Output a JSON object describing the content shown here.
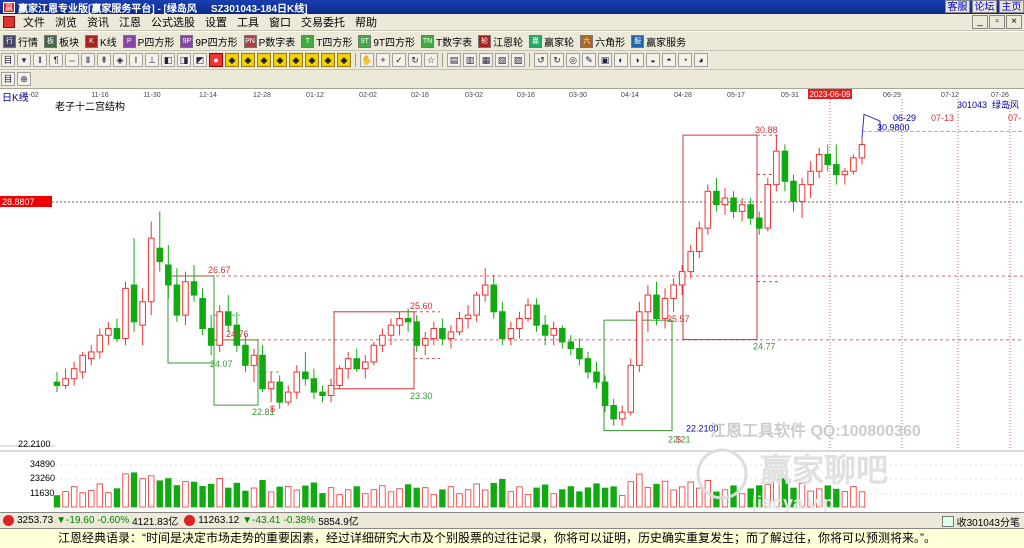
{
  "window": {
    "title": "赢家江恩专业版[赢家服务平台] - [绿岛风",
    "code_title": "SZ301043-184日K线]",
    "links": [
      "客服",
      "论坛",
      "主页"
    ]
  },
  "menu": [
    "文件",
    "浏览",
    "资讯",
    "江恩",
    "公式选股",
    "设置",
    "工具",
    "窗口",
    "交易委托",
    "帮助"
  ],
  "toolbar1": [
    {
      "icon": "行",
      "label": "行情",
      "color": "#446"
    },
    {
      "icon": "板",
      "label": "板块",
      "color": "#464"
    },
    {
      "icon": "K",
      "label": "K线",
      "color": "#a22"
    },
    {
      "icon": "P",
      "label": "P四方形",
      "color": "#84a"
    },
    {
      "icon": "9P",
      "label": "9P四方形",
      "color": "#84a"
    },
    {
      "icon": "PN",
      "label": "P数字表",
      "color": "#a44"
    },
    {
      "icon": "T",
      "label": "T四方形",
      "color": "#4a4"
    },
    {
      "icon": "9T",
      "label": "9T四方形",
      "color": "#4a4"
    },
    {
      "icon": "TN",
      "label": "T数字表",
      "color": "#4a4"
    },
    {
      "icon": "轮",
      "label": "江恩轮",
      "color": "#a22"
    },
    {
      "icon": "赢",
      "label": "赢家轮",
      "color": "#2a6"
    },
    {
      "icon": "六",
      "label": "六角形",
      "color": "#a62"
    },
    {
      "icon": "服",
      "label": "赢家服务",
      "color": "#26a"
    }
  ],
  "chart": {
    "period_label": "日K线",
    "indicator_label": "老子十二宫结构",
    "stock_code": "301043",
    "stock_name": "绿岛风",
    "current_price": "30.9800",
    "price_marker": "28.8807",
    "low_axis_label": "22.2100",
    "volume_ticks": [
      "34890",
      "23260",
      "11630"
    ],
    "date_ticks": [
      "11-02",
      "11-16",
      "11-30",
      "12-14",
      "12-28",
      "01-12",
      "02-02",
      "02-16",
      "03-02",
      "03-16",
      "03-30",
      "04-14",
      "04-28",
      "05-17",
      "05-31",
      "2023-06-09",
      "06-29",
      "07-12",
      "07-26"
    ],
    "annotations": {
      "a_26_67": "26.67",
      "a_24_76": "24.76",
      "a_24_07": "24.07",
      "a_22_81": "22.81",
      "a_25_60": "25.60",
      "a_23_30": "23.30",
      "a_30_88": "30.88",
      "a_25_57": "25.57",
      "a_24_77": "24.77",
      "a_22_21": "22.21",
      "a_22_2100": "22.2100",
      "a_06_29": "06-29",
      "a_07_13": "07-13",
      "a_07": "07-",
      "a_dollar1": "$",
      "a_dollar2": "$"
    },
    "watermark1": "江恩工具软件 QQ:100800360",
    "watermark2": "赢家聊吧",
    "watermark3": "jiaoya.vip"
  },
  "chart_data": {
    "type": "candlestick",
    "ylim": [
      21.5,
      31.6
    ],
    "candles": [
      [
        23.5,
        23.8,
        23.2,
        23.4
      ],
      [
        23.4,
        23.9,
        23.3,
        23.6
      ],
      [
        23.6,
        24.1,
        23.4,
        23.9
      ],
      [
        23.8,
        24.4,
        23.6,
        24.3
      ],
      [
        24.2,
        24.6,
        24.0,
        24.4
      ],
      [
        24.4,
        25.1,
        24.2,
        24.9
      ],
      [
        24.9,
        25.3,
        24.6,
        25.1
      ],
      [
        25.1,
        25.4,
        24.7,
        24.8
      ],
      [
        24.8,
        26.5,
        24.6,
        26.3
      ],
      [
        26.4,
        27.8,
        25.0,
        25.3
      ],
      [
        25.2,
        26.3,
        24.6,
        25.9
      ],
      [
        25.9,
        28.3,
        25.5,
        27.8
      ],
      [
        27.5,
        28.6,
        26.8,
        27.1
      ],
      [
        27.0,
        27.6,
        26.0,
        26.4
      ],
      [
        26.4,
        26.9,
        25.3,
        25.5
      ],
      [
        25.5,
        26.8,
        25.2,
        26.5
      ],
      [
        26.5,
        27.0,
        25.9,
        26.1
      ],
      [
        26.0,
        26.3,
        24.9,
        25.1
      ],
      [
        25.1,
        25.5,
        24.3,
        24.6
      ],
      [
        24.6,
        25.8,
        24.4,
        25.6
      ],
      [
        25.6,
        26.1,
        25.0,
        25.2
      ],
      [
        25.2,
        25.6,
        24.4,
        24.6
      ],
      [
        24.6,
        24.9,
        23.8,
        24.0
      ],
      [
        24.0,
        24.5,
        23.5,
        24.3
      ],
      [
        24.3,
        24.6,
        23.2,
        23.3
      ],
      [
        23.3,
        23.8,
        22.9,
        23.5
      ],
      [
        23.5,
        23.7,
        22.7,
        22.9
      ],
      [
        22.9,
        23.4,
        22.8,
        23.2
      ],
      [
        23.2,
        24.0,
        23.0,
        23.8
      ],
      [
        23.8,
        24.4,
        23.4,
        23.6
      ],
      [
        23.6,
        23.9,
        23.0,
        23.2
      ],
      [
        23.2,
        23.4,
        22.9,
        23.1
      ],
      [
        23.1,
        23.6,
        22.9,
        23.4
      ],
      [
        23.4,
        24.0,
        23.3,
        23.9
      ],
      [
        23.9,
        24.4,
        23.6,
        24.2
      ],
      [
        24.2,
        24.5,
        23.8,
        23.9
      ],
      [
        23.9,
        24.3,
        23.6,
        24.1
      ],
      [
        24.1,
        24.7,
        24.0,
        24.6
      ],
      [
        24.6,
        25.1,
        24.4,
        24.9
      ],
      [
        24.9,
        25.4,
        24.6,
        25.2
      ],
      [
        25.2,
        25.6,
        24.9,
        25.4
      ],
      [
        25.4,
        25.7,
        25.0,
        25.3
      ],
      [
        25.3,
        25.5,
        24.4,
        24.6
      ],
      [
        24.6,
        25.0,
        24.3,
        24.8
      ],
      [
        24.8,
        25.3,
        24.6,
        25.1
      ],
      [
        25.1,
        25.4,
        24.6,
        24.8
      ],
      [
        24.8,
        25.2,
        24.5,
        25.0
      ],
      [
        25.0,
        25.6,
        24.9,
        25.4
      ],
      [
        25.4,
        25.8,
        25.1,
        25.5
      ],
      [
        25.5,
        26.2,
        25.3,
        26.1
      ],
      [
        26.1,
        26.9,
        25.9,
        26.4
      ],
      [
        26.4,
        26.7,
        25.4,
        25.6
      ],
      [
        25.6,
        25.9,
        24.6,
        24.8
      ],
      [
        24.8,
        25.3,
        24.6,
        25.1
      ],
      [
        25.1,
        25.6,
        24.8,
        25.4
      ],
      [
        25.4,
        26.0,
        25.3,
        25.8
      ],
      [
        25.8,
        26.0,
        25.0,
        25.2
      ],
      [
        25.2,
        25.5,
        24.6,
        24.9
      ],
      [
        24.9,
        25.3,
        24.6,
        25.1
      ],
      [
        25.1,
        25.2,
        24.5,
        24.7
      ],
      [
        24.7,
        24.9,
        24.3,
        24.5
      ],
      [
        24.5,
        24.8,
        24.0,
        24.2
      ],
      [
        24.2,
        24.4,
        23.6,
        23.8
      ],
      [
        23.8,
        24.1,
        23.3,
        23.5
      ],
      [
        23.5,
        23.7,
        22.6,
        22.8
      ],
      [
        22.8,
        23.0,
        22.2,
        22.4
      ],
      [
        22.4,
        22.8,
        22.2,
        22.6
      ],
      [
        22.6,
        24.2,
        22.5,
        24.0
      ],
      [
        24.0,
        25.9,
        23.8,
        25.6
      ],
      [
        25.6,
        26.4,
        25.0,
        26.1
      ],
      [
        26.1,
        26.5,
        25.2,
        25.4
      ],
      [
        25.4,
        26.3,
        25.1,
        26.0
      ],
      [
        26.0,
        26.6,
        25.6,
        26.4
      ],
      [
        26.4,
        27.0,
        26.1,
        26.8
      ],
      [
        26.8,
        27.6,
        26.6,
        27.4
      ],
      [
        27.4,
        28.3,
        27.2,
        28.1
      ],
      [
        28.1,
        29.4,
        27.9,
        29.2
      ],
      [
        29.2,
        29.6,
        28.6,
        28.8
      ],
      [
        28.8,
        29.3,
        28.5,
        29.0
      ],
      [
        29.0,
        29.2,
        28.4,
        28.6
      ],
      [
        28.6,
        29.0,
        28.3,
        28.8
      ],
      [
        28.8,
        29.0,
        28.2,
        28.4
      ],
      [
        28.4,
        28.6,
        27.9,
        28.1
      ],
      [
        28.1,
        29.6,
        28.0,
        29.4
      ],
      [
        29.4,
        30.9,
        29.2,
        30.4
      ],
      [
        30.4,
        30.6,
        29.2,
        29.5
      ],
      [
        29.5,
        29.7,
        28.6,
        28.9
      ],
      [
        28.9,
        29.6,
        28.4,
        29.4
      ],
      [
        29.4,
        30.1,
        29.0,
        29.8
      ],
      [
        29.8,
        30.5,
        29.6,
        30.3
      ],
      [
        30.3,
        30.6,
        29.8,
        30.0
      ],
      [
        30.0,
        30.6,
        29.4,
        29.7
      ],
      [
        29.7,
        29.9,
        29.4,
        29.8
      ],
      [
        29.8,
        30.3,
        29.7,
        30.2
      ],
      [
        30.2,
        30.8,
        30.0,
        30.6
      ]
    ]
  }
}
